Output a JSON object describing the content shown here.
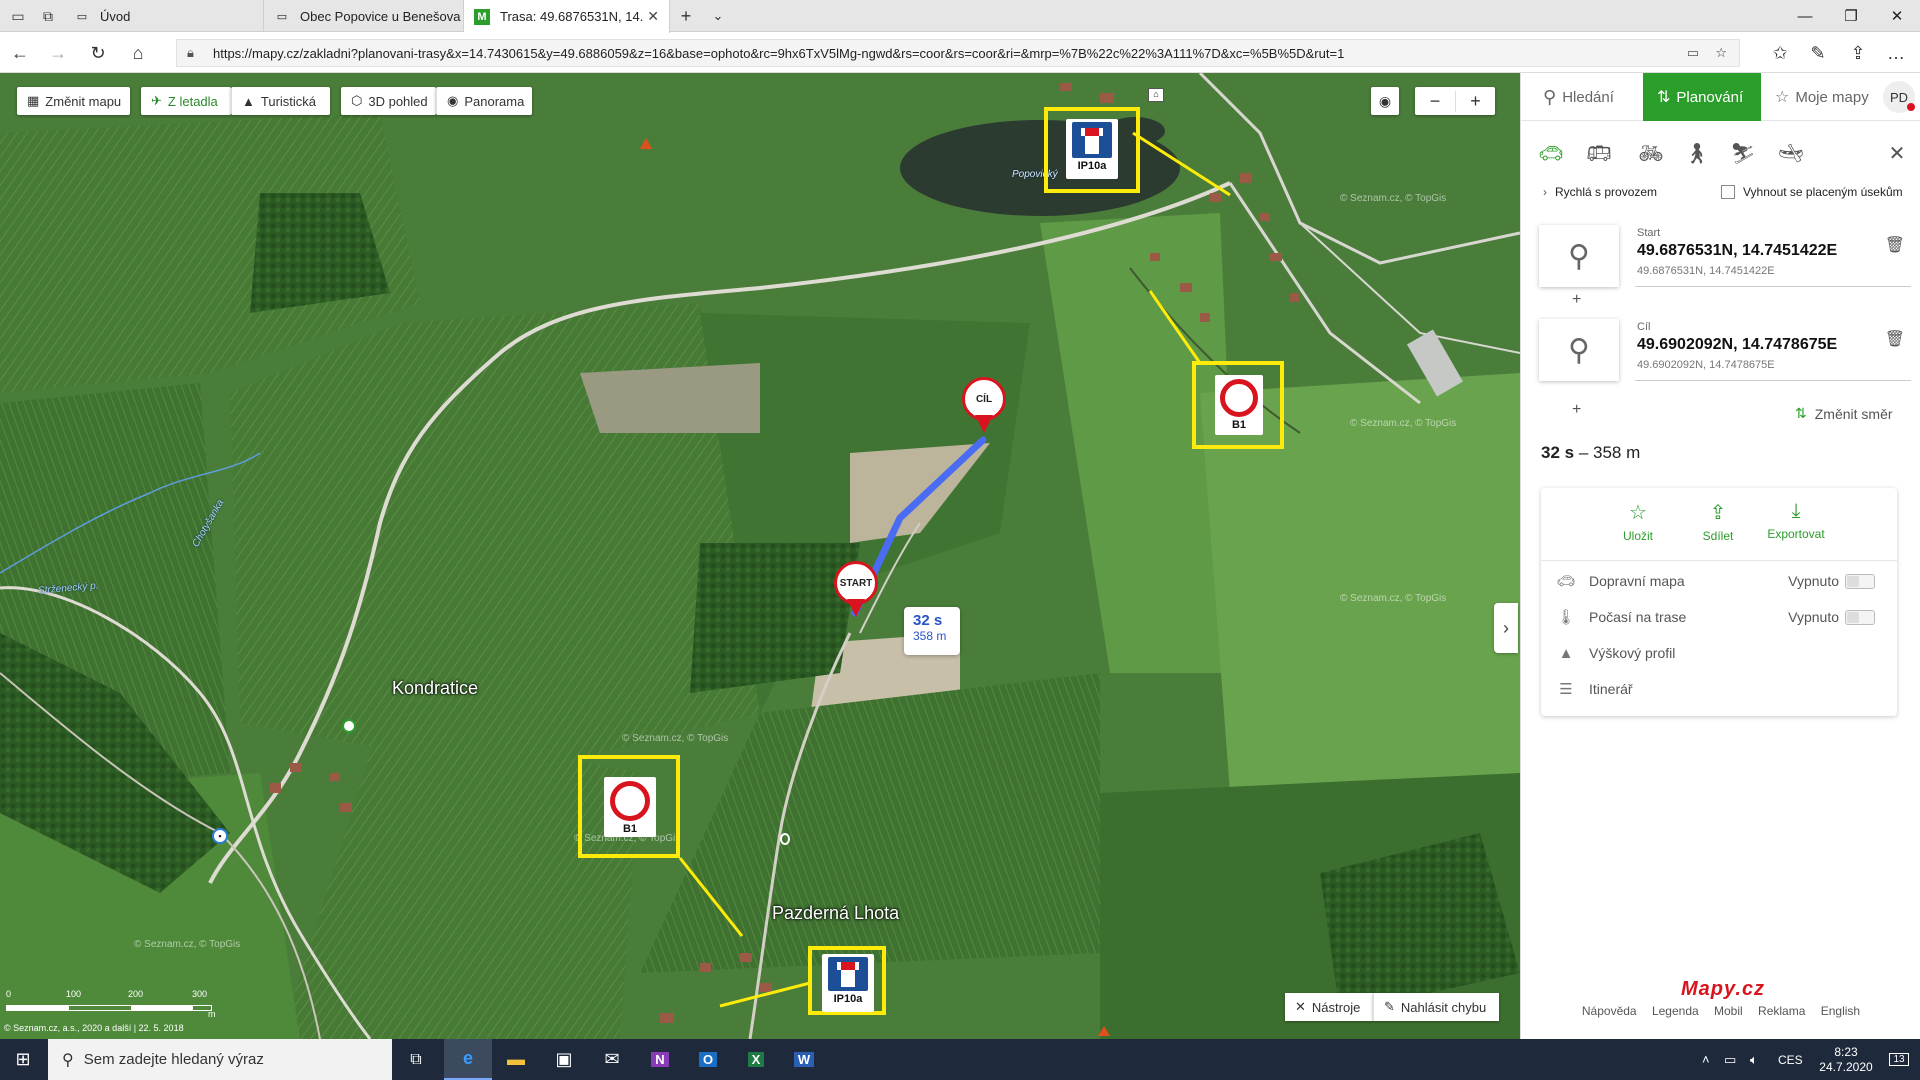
{
  "browser": {
    "tabs": [
      {
        "label": "Úvod"
      },
      {
        "label": "Obec Popovice u Benešova"
      },
      {
        "label": "Trasa: 49.6876531N, 14."
      }
    ],
    "url": "https://mapy.cz/zakladni?planovani-trasy&x=14.7430615&y=49.6886059&z=16&base=ophoto&rc=9hx6TxV5lMg-ngwd&rs=coor&rs=coor&ri=&mrp=%7B%22c%22%3A111%7D&xc=%5B%5D&rut=1"
  },
  "map_toolbar": {
    "change_map": "Změnit mapu",
    "aerial": "Z letadla",
    "tourist": "Turistická",
    "view3d": "3D pohled",
    "panorama": "Panorama",
    "zoom_out": "−",
    "zoom_in": "+"
  },
  "map": {
    "places": {
      "kondratice": "Kondratice",
      "pazderna": "Pazderná Lhota",
      "popovicky": "Popovický"
    },
    "streams": {
      "strzenecky": "Strženecký p.",
      "chotysanka": "Chotyšanka"
    },
    "signs": {
      "ip10a": "IP10a",
      "b1": "B1"
    },
    "pins": {
      "start": "START",
      "cil": "CÍL"
    },
    "route_time": "32 s",
    "route_dist": "358 m",
    "watermark": "© Seznam.cz, © TopGis",
    "scale": [
      "0",
      "100",
      "200",
      "300"
    ],
    "scale_unit": "m",
    "copyright": "© Seznam.cz, a.s., 2020 a další | 22. 5. 2018",
    "tools": "Nástroje",
    "report": "Nahlásit chybu"
  },
  "sidebar": {
    "tabs": {
      "search": "Hledání",
      "planning": "Planování",
      "mymaps": "Moje mapy",
      "avatar": "PD"
    },
    "options": {
      "fast": "Rychlá s provozem",
      "avoid_toll": "Vyhnout se placeným úsekům"
    },
    "start": {
      "label": "Start",
      "main": "49.6876531N, 14.7451422E",
      "sub": "49.6876531N, 14.7451422E"
    },
    "end": {
      "label": "Cíl",
      "main": "49.6902092N, 14.7478675E",
      "sub": "49.6902092N, 14.7478675E"
    },
    "change_dir": "Změnit směr",
    "summary": {
      "time": "32 s",
      "sep": " – ",
      "dist": "358 m"
    },
    "actions": {
      "save": "Uložit",
      "share": "Sdílet",
      "export": "Exportovat"
    },
    "rows": {
      "traffic": "Dopravní mapa",
      "traffic_state": "Vypnuto",
      "weather": "Počasí na trase",
      "weather_state": "Vypnuto",
      "elevation": "Výškový profil",
      "itinerary": "Itinerář"
    },
    "logo": "Mapy.cz",
    "footer": {
      "help": "Nápověda",
      "legend": "Legenda",
      "mobile": "Mobil",
      "ads": "Reklama",
      "english": "English"
    }
  },
  "taskbar": {
    "search_placeholder": "Sem zadejte hledaný výraz",
    "lang": "CES",
    "time": "8:23",
    "date": "24.7.2020",
    "notifications": "13"
  }
}
